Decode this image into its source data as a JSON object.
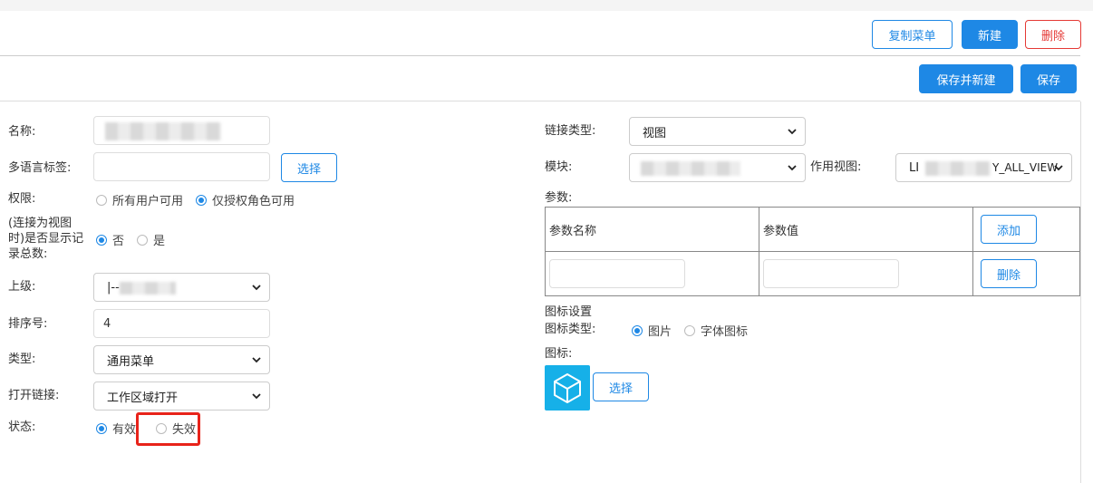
{
  "toolbar": {
    "copy_menu": "复制菜单",
    "new": "新建",
    "delete": "删除",
    "save_and_new": "保存并新建",
    "save": "保存"
  },
  "form_left": {
    "name_label": "名称:",
    "i18n_label": "多语言标签:",
    "i18n_select_button": "选择",
    "permission_label": "权限:",
    "permission_options": [
      "所有用户可用",
      "仅授权角色可用"
    ],
    "permission_selected": "仅授权角色可用",
    "show_count_label_line1": "(连接为视图",
    "show_count_label_line2": "时)是否显示记",
    "show_count_label_line3": "录总数:",
    "show_count_options": [
      "否",
      "是"
    ],
    "show_count_selected": "否",
    "parent_label": "上级:",
    "parent_value": "|--",
    "order_label": "排序号:",
    "order_value": "4",
    "type_label": "类型:",
    "type_value": "通用菜单",
    "open_link_label": "打开链接:",
    "open_link_value": "工作区域打开",
    "status_label": "状态:",
    "status_options": [
      "有效",
      "失效"
    ],
    "status_selected": "有效"
  },
  "form_right": {
    "link_type_label": "链接类型:",
    "link_type_value": "视图",
    "module_label": "模块:",
    "view_label": "作用视图:",
    "view_value_prefix": "LI",
    "view_value_suffix": "Y_ALL_VIEW",
    "params_label": "参数:",
    "params_table": {
      "col_name": "参数名称",
      "col_value": "参数值",
      "add_button": "添加",
      "delete_button": "删除"
    },
    "icon_settings_label": "图标设置",
    "icon_type_label": "图标类型:",
    "icon_type_options": [
      "图片",
      "字体图标"
    ],
    "icon_type_selected": "图片",
    "icon_label": "图标:",
    "icon_select_button": "选择",
    "icon_preview": "cube-icon"
  },
  "colors": {
    "primary": "#1e88e5",
    "danger": "#e53935",
    "highlight": "#e8231a",
    "icon_bg": "#16b0e8"
  }
}
